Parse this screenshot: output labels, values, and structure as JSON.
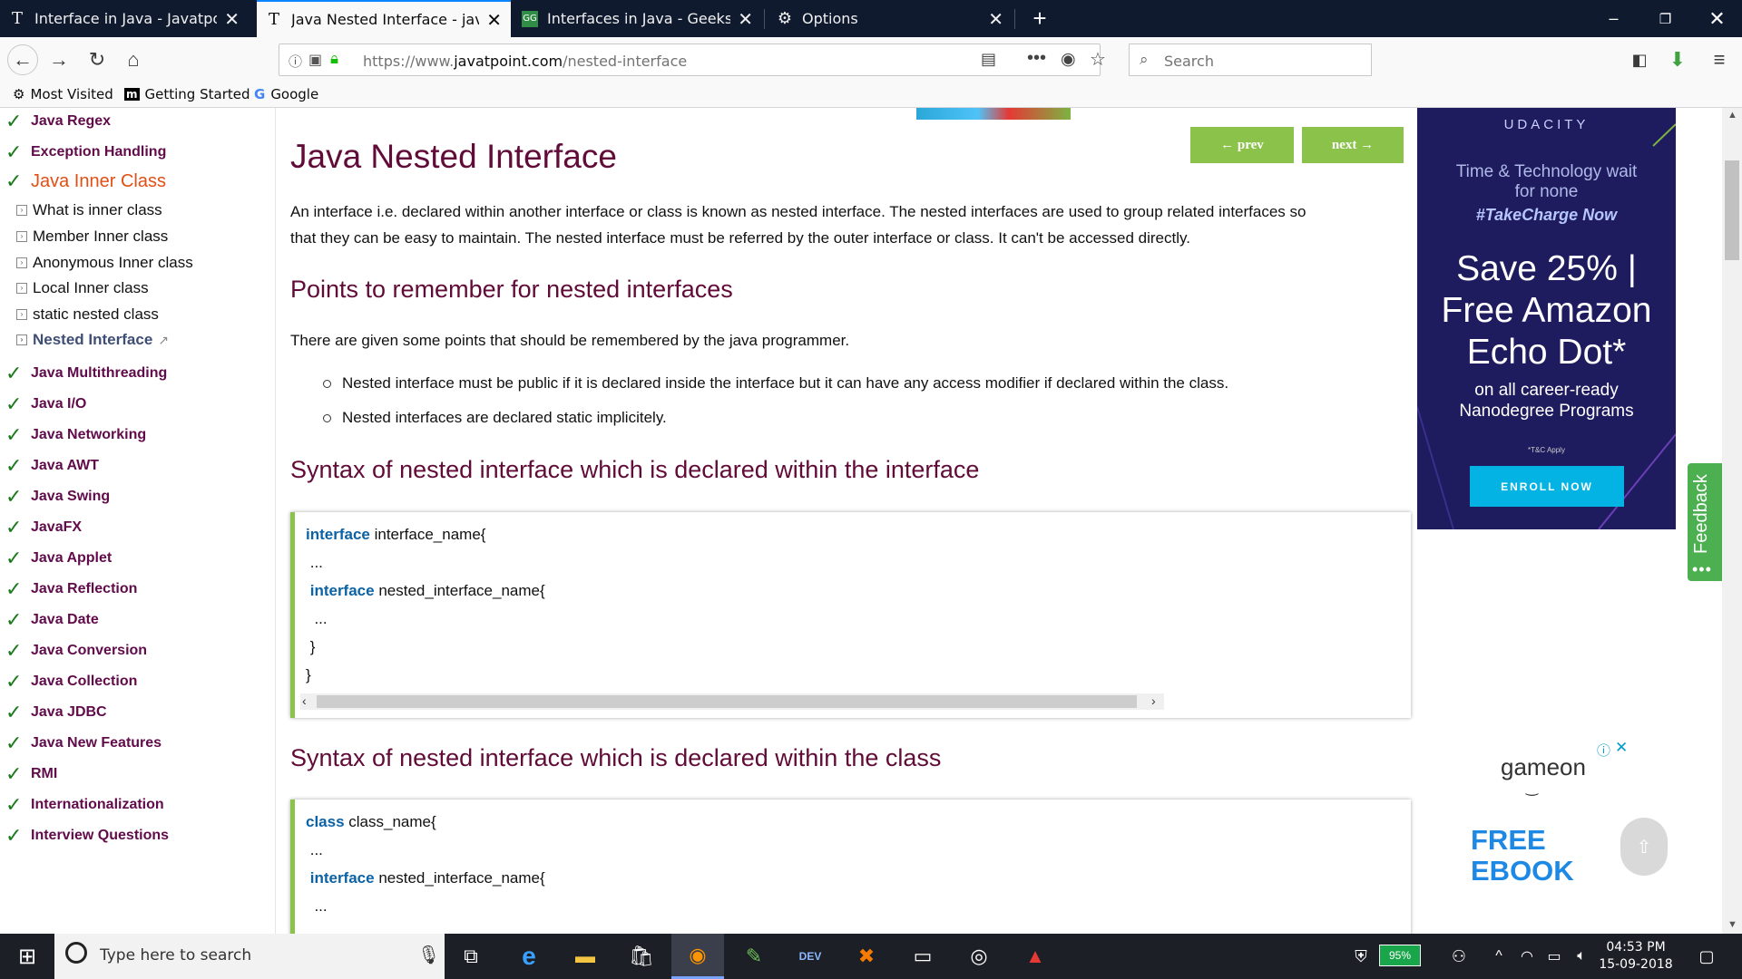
{
  "tabs": [
    {
      "title": "Interface in Java - Javatpoint",
      "favicon": "T",
      "active": false
    },
    {
      "title": "Java Nested Interface - javatpo",
      "favicon": "T",
      "active": true
    },
    {
      "title": "Interfaces in Java - GeeksforGe",
      "favicon": "GG",
      "active": false
    },
    {
      "title": "Options",
      "favicon": "gear-icon",
      "active": false
    }
  ],
  "url": {
    "prefix": "https://www.",
    "domain": "javatpoint.com",
    "path": "/nested-interface"
  },
  "search_placeholder": "Search",
  "bookmarks": [
    {
      "label": "Most Visited",
      "icon": "gear-icon"
    },
    {
      "label": "Getting Started",
      "icon": "mozilla-icon"
    },
    {
      "label": "Google",
      "icon": "google-icon"
    }
  ],
  "sidebar": {
    "top_items": [
      "Java Regex",
      "Exception Handling"
    ],
    "current": "Java Inner Class",
    "sub_items": [
      "What is inner class",
      "Member Inner class",
      "Anonymous Inner class",
      "Local Inner class",
      "static nested class",
      "Nested Interface"
    ],
    "items": [
      "Java Multithreading",
      "Java I/O",
      "Java Networking",
      "Java AWT",
      "Java Swing",
      "JavaFX",
      "Java Applet",
      "Java Reflection",
      "Java Date",
      "Java Conversion",
      "Java Collection",
      "Java JDBC",
      "Java New Features",
      "RMI",
      "Internationalization",
      "Interview Questions"
    ]
  },
  "article": {
    "title": "Java Nested Interface",
    "prev": "← prev",
    "next": "next →",
    "intro_1": "An interface i.e. declared within another interface or class is known as nested interface. The nested interfaces are used to group related interfaces so",
    "intro_2": "that they can be easy to maintain. The nested interface must be referred by the outer interface or class. It can't be accessed directly.",
    "h_points": "Points to remember for nested interfaces",
    "points_intro": "There are given some points that should be remembered by the java programmer.",
    "bullets": [
      "Nested interface must be public if it is declared inside the interface but it can have any access modifier if declared within the class.",
      "Nested interfaces are declared static implicitely."
    ],
    "h_syntax1": "Syntax of nested interface which is declared within the interface",
    "code1": [
      {
        "kw": "interface",
        "rest": " interface_name{"
      },
      {
        "kw": "",
        "rest": " ..."
      },
      {
        "kw": " interface",
        "rest": " nested_interface_name{"
      },
      {
        "kw": "",
        "rest": "  ..."
      },
      {
        "kw": "",
        "rest": " }"
      },
      {
        "kw": "",
        "rest": "}"
      }
    ],
    "h_syntax2": "Syntax of nested interface which is declared within the class",
    "code2": [
      {
        "kw": "class",
        "rest": " class_name{"
      },
      {
        "kw": "",
        "rest": " ..."
      },
      {
        "kw": " interface",
        "rest": " nested_interface_name{"
      },
      {
        "kw": "",
        "rest": "  ..."
      }
    ]
  },
  "ad": {
    "brand": "UDACITY",
    "line1a": "Time & Technology wait",
    "line1b": "for none",
    "line2": "#TakeCharge Now",
    "big_1": "Save 25% |",
    "big_2": "Free Amazon",
    "big_3": "Echo Dot*",
    "small_1": "on all career-ready",
    "small_2": "Nanodegree Programs",
    "tc": "*T&C Apply",
    "enroll": "ENROLL NOW"
  },
  "feedback": "Feedback",
  "gameon": {
    "logo": "gameon",
    "free": "FREE",
    "ebook": "EBOOK"
  },
  "taskbar": {
    "search_placeholder": "Type here to search",
    "battery": "95%",
    "time": "04:53 PM",
    "date": "15-09-2018"
  },
  "colors": {
    "accent_green": "#8bc34a",
    "heading": "#610b38",
    "ad_bg": "#1e1b5e",
    "tab_bg": "#0f1a2f"
  }
}
